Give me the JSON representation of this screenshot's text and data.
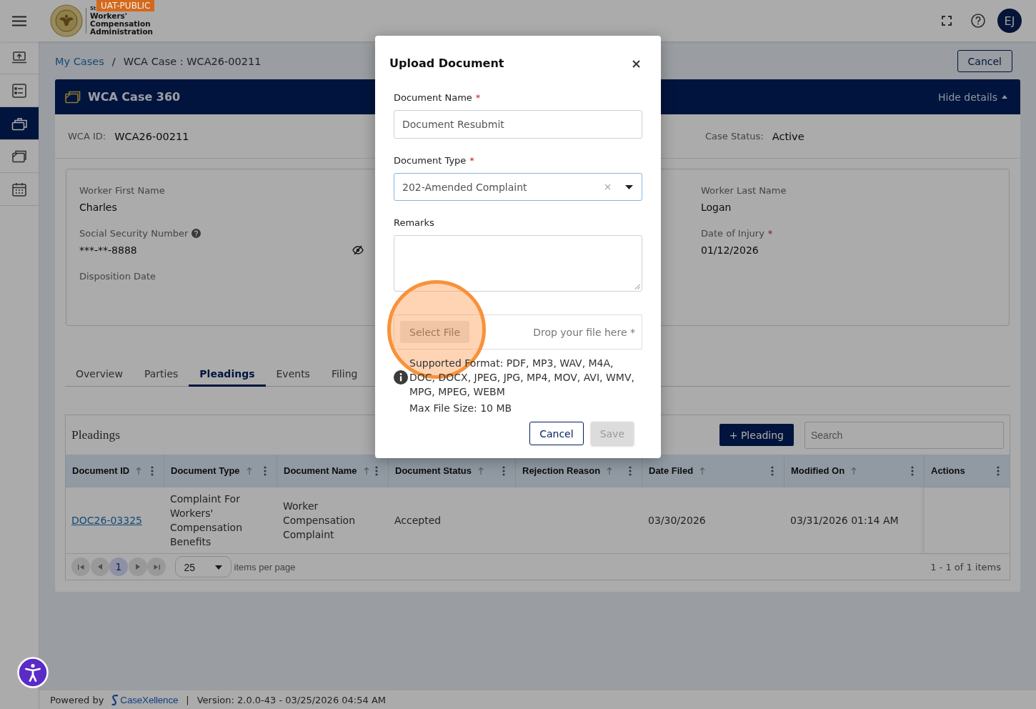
{
  "topbar": {
    "badge": "UAT-PUBLIC",
    "logo_kicker": "St",
    "logo_lines": [
      "Workers'",
      "Compensation",
      "Administration"
    ],
    "avatar": "EJ"
  },
  "sidebar": {
    "items": [
      {
        "kind": "upload",
        "selected": false
      },
      {
        "kind": "checklist",
        "selected": false
      },
      {
        "kind": "briefcase",
        "selected": true
      },
      {
        "kind": "folder",
        "selected": false
      },
      {
        "kind": "calendar",
        "selected": false
      }
    ]
  },
  "breadcrumb": {
    "items": [
      {
        "label": "My Cases",
        "link": true
      },
      {
        "label": "WCA Case : WCA26-00211",
        "link": false
      }
    ],
    "separator": "/"
  },
  "page_cancel": "Cancel",
  "case": {
    "title": "WCA Case 360",
    "toggle": "Hide details",
    "expanded": true,
    "summary": [
      {
        "label": "WCA ID:",
        "value": "WCA26-00211"
      },
      {
        "label": "Case Status:",
        "value": "Active"
      }
    ],
    "details": {
      "left_fields": [
        {
          "label": "Worker First Name",
          "value": "Charles"
        },
        {
          "label": "Social Security Number",
          "value": "***-**-8888",
          "help": true,
          "reveal": true
        },
        {
          "label": "Disposition Date"
        }
      ],
      "right_fields": [
        {
          "label": "Worker Last Name",
          "value": "Logan"
        },
        {
          "label": "Date of Injury",
          "required_mark": "*",
          "value": "01/12/2026"
        }
      ]
    }
  },
  "tabs": [
    {
      "label": "Overview",
      "selected": false
    },
    {
      "label": "Parties",
      "selected": false
    },
    {
      "label": "Pleadings",
      "selected": true
    },
    {
      "label": "Events",
      "selected": false
    },
    {
      "label": "Filing",
      "selected": false
    }
  ],
  "pleadings": {
    "title": "Pleadings",
    "add_button": "+ Pleading",
    "search": {
      "placeholder": "Search"
    },
    "table": {
      "columns": [
        {
          "label": "Document ID",
          "sortable": true
        },
        {
          "label": "Document Type",
          "sortable": true
        },
        {
          "label": "Document Name",
          "sortable": true
        },
        {
          "label": "Document Status",
          "sortable": true
        },
        {
          "label": "Rejection Reason",
          "sortable": true
        },
        {
          "label": "Date Filed",
          "sortable": true
        },
        {
          "label": "Modified On",
          "sortable": true
        },
        {
          "label": "Actions",
          "sortable": false
        }
      ],
      "rows": [
        {
          "cells": [
            {
              "kind": "link",
              "text": "DOC26-03325"
            },
            {
              "kind": "text",
              "text": "Complaint For Workers' Compensation Benefits"
            },
            {
              "kind": "text",
              "text": "Worker Compensation Complaint"
            },
            {
              "kind": "text",
              "text": "Accepted"
            },
            {
              "kind": "empty"
            },
            {
              "kind": "text",
              "text": "03/30/2026"
            },
            {
              "kind": "text",
              "text": "03/31/2026 01:14 AM"
            },
            {
              "kind": "empty"
            }
          ]
        }
      ]
    },
    "pager": {
      "pages": [
        {
          "label": "1",
          "selected": true
        }
      ],
      "page_size": "25",
      "page_size_label": "items per page",
      "summary": "1 - 1 of 1 items"
    }
  },
  "modal": {
    "title": "Upload Document",
    "fields": [
      {
        "kind": "text",
        "label": "Document Name",
        "required_mark": "*",
        "value": "Document Resubmit",
        "focused": false
      },
      {
        "kind": "select",
        "label": "Document Type",
        "required_mark": "*",
        "value": "202-Amended Complaint",
        "focused": true,
        "clearable": true
      },
      {
        "kind": "textarea",
        "label": "Remarks",
        "focused": false
      }
    ],
    "file_drop": {
      "button": "Select File",
      "hint": "Drop your file here *",
      "highlighted": true
    },
    "info": {
      "formats": "Supported Format: PDF, MP3, WAV, M4A, DOC, DOCX, JPEG, JPG, MP4, MOV, AVI, WMV, MPG, MPEG, WEBM",
      "max_size": "Max File Size: 10 MB"
    },
    "buttons": [
      {
        "label": "Cancel",
        "kind": "secondary",
        "disabled": false
      },
      {
        "label": "Save",
        "kind": "primary",
        "disabled": true
      }
    ]
  },
  "footer": {
    "powered_by": "Powered by",
    "brand": "CaseXellence",
    "separator": "|",
    "version": "Version: 2.0.0-43 - 03/25/2026 04:54 AM"
  }
}
